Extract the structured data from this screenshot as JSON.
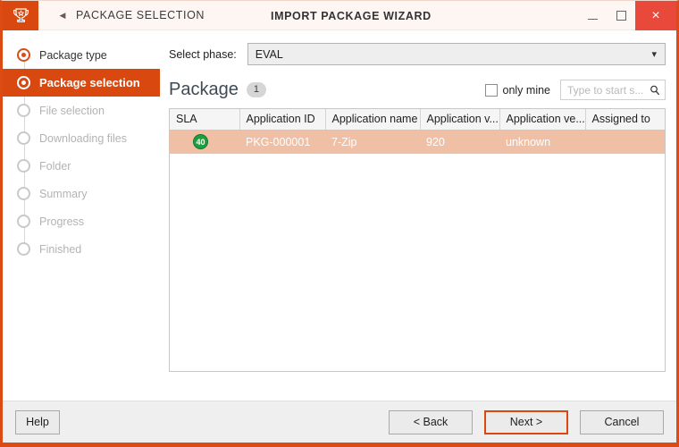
{
  "titlebar": {
    "logo_icon": "trophy-icon",
    "back_arrow_icon": "chevron-left-icon",
    "breadcrumb": "PACKAGE SELECTION",
    "wizard_title": "IMPORT PACKAGE WIZARD",
    "minimize_icon": "minimize-icon",
    "maximize_icon": "maximize-icon",
    "close_icon": "close-icon",
    "close_glyph": "×",
    "accent_color": "#d9480f",
    "close_color": "#e8493b"
  },
  "sidebar": {
    "steps": [
      {
        "label": "Package type",
        "state": "done"
      },
      {
        "label": "Package selection",
        "state": "active"
      },
      {
        "label": "File selection",
        "state": "pending"
      },
      {
        "label": "Downloading files",
        "state": "pending"
      },
      {
        "label": "Folder",
        "state": "pending"
      },
      {
        "label": "Summary",
        "state": "pending"
      },
      {
        "label": "Progress",
        "state": "pending"
      },
      {
        "label": "Finished",
        "state": "pending"
      }
    ]
  },
  "content": {
    "phase": {
      "label": "Select phase:",
      "value": "EVAL",
      "caret_icon": "chevron-down-icon",
      "options": [
        "EVAL"
      ]
    },
    "package": {
      "title": "Package",
      "count": "1",
      "only_mine_label": "only mine",
      "only_mine_checked": false,
      "search_placeholder": "Type to start s...",
      "search_value": "",
      "search_icon": "search-icon"
    },
    "table": {
      "columns": [
        "SLA",
        "Application ID",
        "Application name",
        "Application v...",
        "Application ve...",
        "Assigned to"
      ],
      "rows": [
        {
          "selected": true,
          "sla": "40",
          "sla_color": "#1f9e3e",
          "app_id": "PKG-000001",
          "app_name": "7-Zip",
          "app_v": "920",
          "app_ve": "unknown",
          "assigned_to": ""
        }
      ]
    }
  },
  "footer": {
    "help": "Help",
    "back": "< Back",
    "next": "Next >",
    "cancel": "Cancel"
  }
}
